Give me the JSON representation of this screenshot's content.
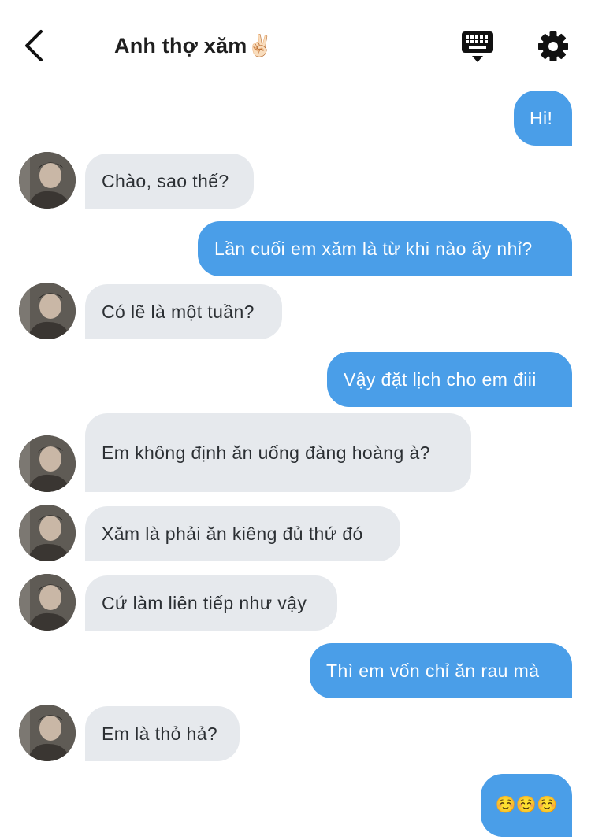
{
  "header": {
    "title": "Anh thợ xăm✌🏻",
    "back_icon": "chevron-left-icon",
    "keyboard_icon": "keyboard-icon",
    "settings_icon": "gear-icon"
  },
  "colors": {
    "incoming_bubble": "#e6e9ed",
    "outgoing_bubble": "#4a9ee8",
    "incoming_text": "#2b2f33",
    "outgoing_text": "#ffffff"
  },
  "messages": [
    {
      "sender": "me",
      "text": "Hi!"
    },
    {
      "sender": "other",
      "text": "Chào, sao thế?"
    },
    {
      "sender": "me",
      "text": "Lần cuối em xăm là từ khi nào ấy nhỉ?"
    },
    {
      "sender": "other",
      "text": "Có lẽ là một tuần?"
    },
    {
      "sender": "me",
      "text": "Vậy đặt lịch cho em điii"
    },
    {
      "sender": "other",
      "text": "Em không định ăn uống đàng hoàng à?"
    },
    {
      "sender": "other",
      "text": "Xăm là phải ăn kiêng đủ thứ đó"
    },
    {
      "sender": "other",
      "text": "Cứ làm liên tiếp như vậy"
    },
    {
      "sender": "me",
      "text": "Thì em vốn chỉ ăn rau mà"
    },
    {
      "sender": "other",
      "text": "Em là thỏ hả?"
    },
    {
      "sender": "me",
      "text": "☺️☺️☺️"
    }
  ]
}
